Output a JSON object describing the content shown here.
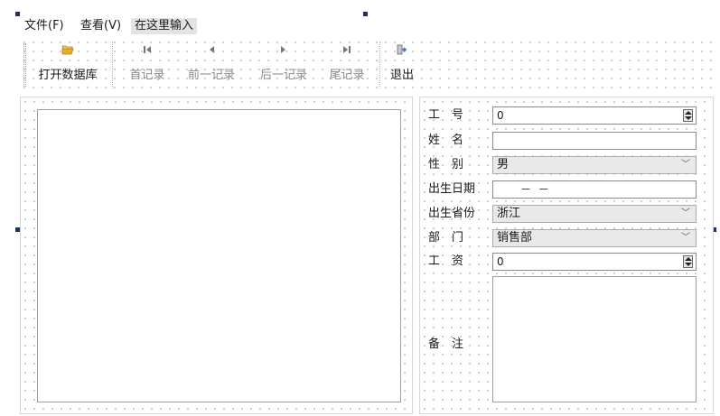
{
  "menu": {
    "file": "文件(F)",
    "view": "查看(V)",
    "type_here": "在这里输入"
  },
  "toolbar": {
    "open_db": "打开数据库",
    "first": "首记录",
    "prev": "前一记录",
    "next": "后一记录",
    "last": "尾记录",
    "exit": "退出"
  },
  "form": {
    "labels": {
      "id": "工　号",
      "name": "姓　名",
      "gender": "性　别",
      "birth_date": "出生日期",
      "birth_province": "出生省份",
      "department": "部　门",
      "salary": "工　资",
      "notes": "备　注"
    },
    "values": {
      "id": "0",
      "name": "",
      "gender": "男",
      "birth_date": "－ －",
      "birth_province": "浙江",
      "department": "销售部",
      "salary": "0",
      "notes": ""
    }
  },
  "icons": {
    "open": "folder-open-icon",
    "first": "first-record-icon",
    "prev": "previous-record-icon",
    "next": "next-record-icon",
    "last": "last-record-icon",
    "exit": "exit-door-icon"
  },
  "colors": {
    "handle": "#1a2f7a",
    "folder": "#e8b020",
    "exit_arrow": "#2a6fd6"
  }
}
